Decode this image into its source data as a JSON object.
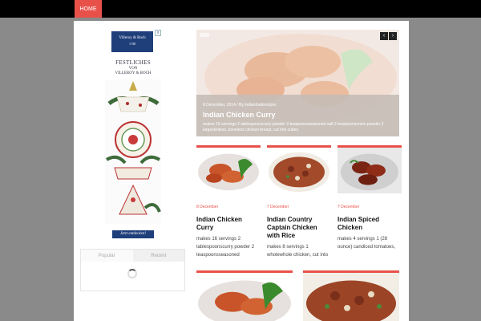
{
  "nav": {
    "home": "HOME"
  },
  "ad": {
    "brand": "Villeroy & Boch",
    "brand_sub": "1748",
    "headline": "FESTLICHES",
    "sub1": "VON",
    "sub2": "VILLEROY & BOCH",
    "cta": "Jetzt entdecken!",
    "close": "x"
  },
  "tabs": {
    "popular": "Popular",
    "recent": "Recent"
  },
  "slider": {
    "date": "8 December, 2014 / By indianfoodrecipes",
    "title": "Indian Chicken Curry",
    "excerpt": "makes 16 servings 2 tablespoonscurry powder 2 teaspoonsseasoned salt 2 teaspoonsonion powder 2 largeskinless, boneless chicken breast, cut into cubes",
    "prev": "‹",
    "next": "›"
  },
  "cards": [
    {
      "date": "8 December",
      "title": "Indian Chicken Curry",
      "excerpt": "makes 16 servings 2 tablespoonscurry powder 2 teaspoonsseasoned"
    },
    {
      "date": "7 December",
      "title": "Indian Country Captain Chicken with Rice",
      "excerpt": "makes 8 servings  1 wholewhole chicken, cut into"
    },
    {
      "date": "7 December",
      "title": "Indian Spiced Chicken",
      "excerpt": "makes 4 servings  1 (28 ounce) candiced tomatoes,"
    }
  ],
  "colors": {
    "accent": "#e8514a",
    "topbar": "#000000",
    "brand_blue": "#1f3f7a"
  }
}
